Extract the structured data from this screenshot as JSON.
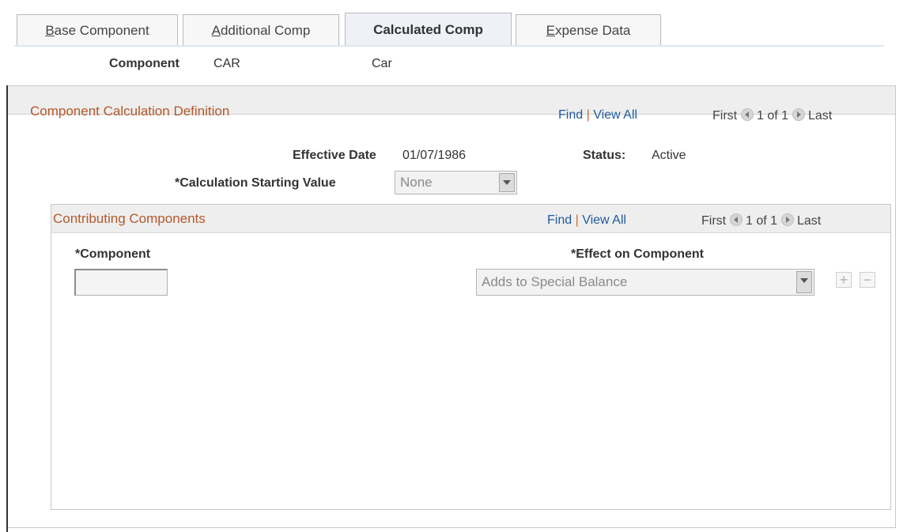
{
  "tabs": [
    {
      "label": "Base Component",
      "access_key": "B",
      "rest": "ase Component",
      "active": false
    },
    {
      "label": "Additional Comp",
      "access_key": "A",
      "rest": "dditional Comp",
      "active": false
    },
    {
      "label": "Calculated Comp",
      "active": true
    },
    {
      "label": "Expense Data",
      "access_key": "E",
      "rest": "xpense Data",
      "active": false
    }
  ],
  "header": {
    "component_label": "Component",
    "component_code": "CAR",
    "component_name": "Car"
  },
  "calc_def": {
    "title": "Component Calculation Definition",
    "nav": {
      "find": "Find",
      "sep": "|",
      "view_all": "View All",
      "first": "First",
      "count": "1 of 1",
      "last": "Last"
    },
    "effective_date_label": "Effective Date",
    "effective_date": "01/07/1986",
    "status_label": "Status:",
    "status": "Active",
    "starting_value_label": "*Calculation Starting Value",
    "starting_value": "None"
  },
  "contrib": {
    "title": "Contributing Components",
    "nav": {
      "find": "Find",
      "sep": "|",
      "view_all": "View All",
      "first": "First",
      "count": "1 of 1",
      "last": "Last"
    },
    "component_label": "*Component",
    "component_value": "",
    "effect_label": "*Effect on Component",
    "effect_value": "Adds to Special Balance",
    "add_symbol": "+",
    "remove_symbol": "−"
  }
}
